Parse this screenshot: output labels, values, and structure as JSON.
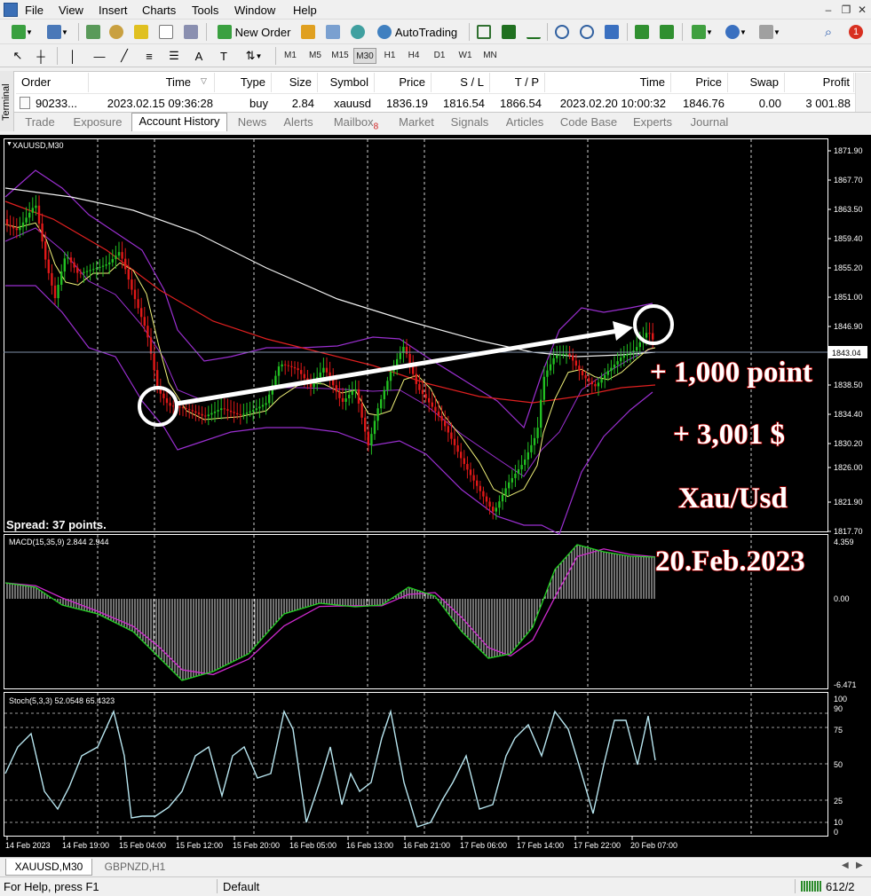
{
  "menu": [
    "File",
    "View",
    "Insert",
    "Charts",
    "Tools",
    "Window",
    "Help"
  ],
  "toolbar": {
    "new_order": "New Order",
    "autotrading": "AutoTrading"
  },
  "timeframes": [
    "M1",
    "M5",
    "M15",
    "M30",
    "H1",
    "H4",
    "D1",
    "W1",
    "MN"
  ],
  "timeframe_selected": "M30",
  "terminal": {
    "side_label": "Terminal",
    "columns": [
      "Order",
      "Time",
      "Type",
      "Size",
      "Symbol",
      "Price",
      "S / L",
      "T / P",
      "Time",
      "Price",
      "Swap",
      "Profit"
    ],
    "row": [
      "90233...",
      "2023.02.15 09:36:28",
      "buy",
      "2.84",
      "xauusd",
      "1836.19",
      "1816.54",
      "1866.54",
      "2023.02.20 10:00:32",
      "1846.76",
      "0.00",
      "3 001.88"
    ],
    "tabs": [
      "Trade",
      "Exposure",
      "Account History",
      "News",
      "Alerts",
      "Mailbox",
      "Market",
      "Signals",
      "Articles",
      "Code Base",
      "Experts",
      "Journal"
    ],
    "active_tab": "Account History",
    "mailbox_badge": "8"
  },
  "chart": {
    "symbol_label": "XAUUSD,M30",
    "spread": "Spread: 37 points.",
    "current_price": "1843.04",
    "price_ticks": [
      "1871.90",
      "1867.70",
      "1863.50",
      "1859.40",
      "1855.20",
      "1851.00",
      "1846.90",
      "1838.50",
      "1834.40",
      "1830.20",
      "1826.00",
      "1821.90",
      "1817.70"
    ],
    "macd_label": "MACD(15,35,9) 2.844 2.944",
    "macd_ticks": [
      "4.359",
      "0.00",
      "-6.471"
    ],
    "stoch_label": "Stoch(5,3,3) 52.0548 65.4323",
    "stoch_ticks": [
      "100",
      "90",
      "75",
      "50",
      "25",
      "10",
      "0"
    ],
    "time_ticks": [
      "14 Feb 2023",
      "14 Feb 19:00",
      "15 Feb 04:00",
      "15 Feb 12:00",
      "15 Feb 20:00",
      "16 Feb 05:00",
      "16 Feb 13:00",
      "16 Feb 21:00",
      "17 Feb 06:00",
      "17 Feb 14:00",
      "17 Feb 22:00",
      "20 Feb 07:00"
    ],
    "annotations": [
      "+ 1,000 point",
      "+ 3,001 $",
      "Xau/Usd",
      "20.Feb.2023"
    ],
    "colors": {
      "bull": "#22c022",
      "bear": "#e01818",
      "bands": "#9a2fd0",
      "ma_fast": "#f2f27a",
      "ma_mid": "#e02020",
      "ma_slow": "#f0f0f0",
      "macd_hist": "#e0e0e0",
      "macd_main": "#22d022",
      "macd_signal": "#d02ad0",
      "stoch": "#b8e6f0",
      "annotation": "#b00000"
    }
  },
  "chart_tabs": [
    "XAUUSD,M30",
    "GBPNZD,H1"
  ],
  "status": {
    "help": "For Help, press F1",
    "profile": "Default",
    "traffic": "612/2"
  }
}
